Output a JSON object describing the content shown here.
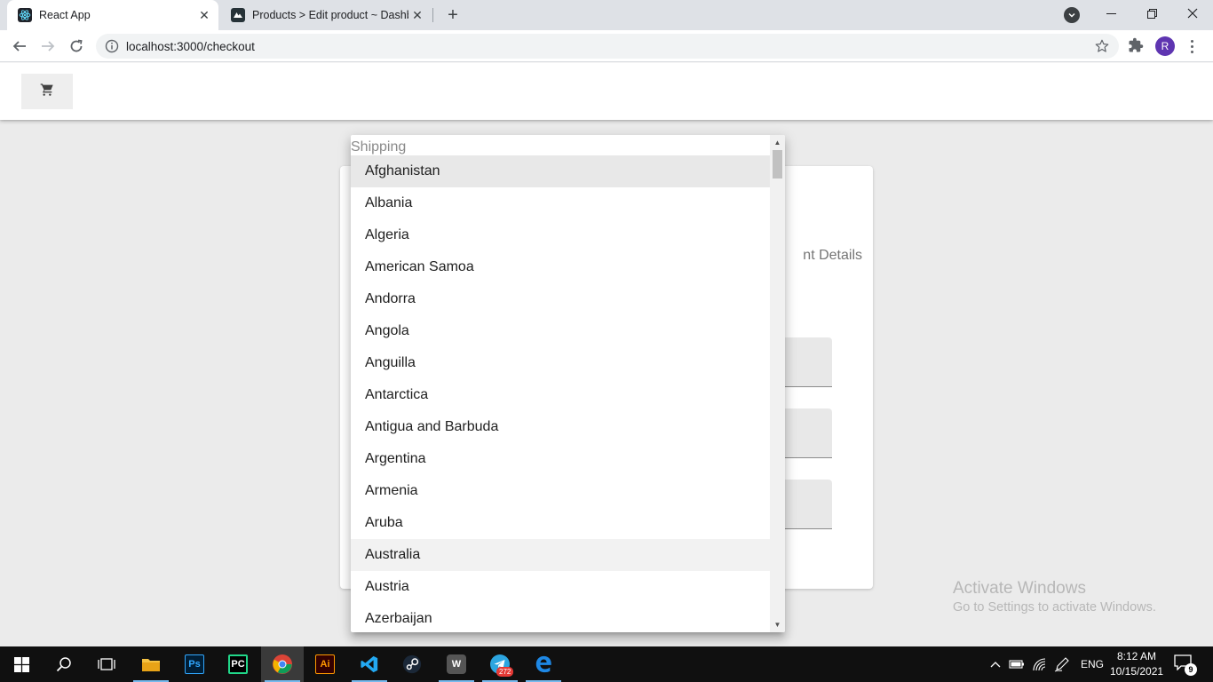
{
  "browser": {
    "tabs": [
      {
        "title": "React App",
        "active": true
      },
      {
        "title": "Products > Edit product ~ Dashb",
        "active": false
      }
    ],
    "url": "localhost:3000/checkout",
    "profile_initial": "R"
  },
  "page": {
    "stepper_partial_label": "nt Details"
  },
  "menu": {
    "header": "Shipping",
    "items": [
      "Afghanistan",
      "Albania",
      "Algeria",
      "American Samoa",
      "Andorra",
      "Angola",
      "Anguilla",
      "Antarctica",
      "Antigua and Barbuda",
      "Argentina",
      "Armenia",
      "Aruba",
      "Australia",
      "Austria",
      "Azerbaijan"
    ],
    "focused_item": "Afghanistan",
    "selected_item": "Australia"
  },
  "watermark": {
    "line1": "Activate Windows",
    "line2": "Go to Settings to activate Windows."
  },
  "taskbar": {
    "apps": [
      "start",
      "search",
      "task-view",
      "file-explorer",
      "photoshop",
      "pycharm",
      "chrome",
      "illustrator",
      "vscode",
      "steam",
      "wampserver",
      "telegram",
      "edge"
    ],
    "app_labels": {
      "photoshop": "Ps",
      "pycharm": "PC",
      "illustrator": "Ai",
      "wampserver": "W"
    },
    "telegram_badge": "272",
    "language": "ENG",
    "time": "8:12 AM",
    "date": "10/15/2021",
    "notification_count": "9"
  },
  "colors": {
    "accent_purple": "#5e35b1",
    "taskbar": "#101010"
  }
}
